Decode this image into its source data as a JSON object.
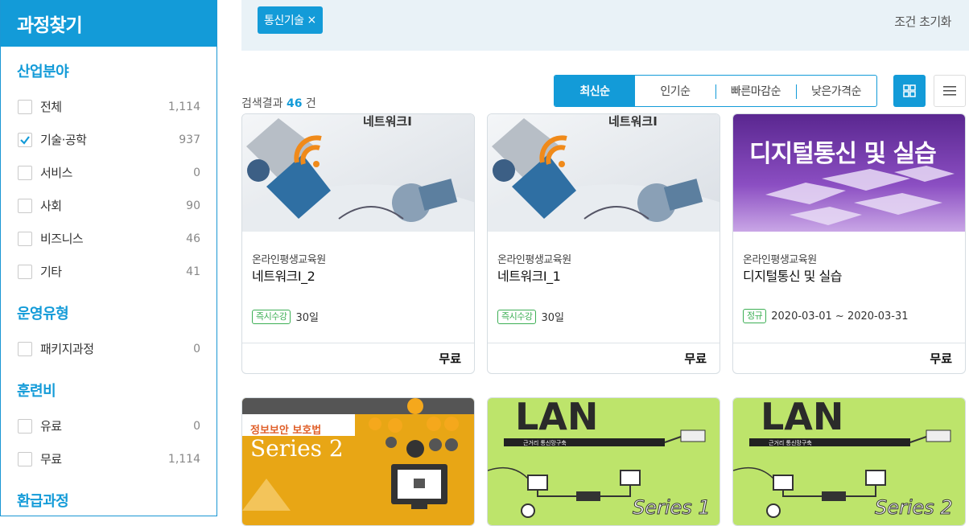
{
  "sidebar": {
    "title": "과정찾기",
    "sections": [
      {
        "title": "산업분야",
        "items": [
          {
            "label": "전체",
            "count": "1,114",
            "checked": false
          },
          {
            "label": "기술·공학",
            "count": "937",
            "checked": true
          },
          {
            "label": "서비스",
            "count": "0",
            "checked": false
          },
          {
            "label": "사회",
            "count": "90",
            "checked": false
          },
          {
            "label": "비즈니스",
            "count": "46",
            "checked": false
          },
          {
            "label": "기타",
            "count": "41",
            "checked": false
          }
        ]
      },
      {
        "title": "운영유형",
        "items": [
          {
            "label": "패키지과정",
            "count": "0",
            "checked": false
          }
        ]
      },
      {
        "title": "훈련비",
        "items": [
          {
            "label": "유료",
            "count": "0",
            "checked": false
          },
          {
            "label": "무료",
            "count": "1,114",
            "checked": false
          }
        ]
      },
      {
        "title": "환급과정",
        "items": []
      }
    ]
  },
  "filter_bar": {
    "tag_label": "통신기술",
    "tag_close": "×",
    "reset_label": "조건 초기화"
  },
  "results": {
    "prefix": "검색결과",
    "count": "46",
    "suffix": "건"
  },
  "sort_tabs": [
    "최신순",
    "인기순",
    "빠른마감순",
    "낮은가격순"
  ],
  "cards": [
    {
      "provider": "온라인평생교육원",
      "title": "네트워크Ⅰ_2",
      "badge": "즉시수강",
      "meta": "30일",
      "price": "무료",
      "thumb_text": "네트워크Ⅰ"
    },
    {
      "provider": "온라인평생교육원",
      "title": "네트워크Ⅰ_1",
      "badge": "즉시수강",
      "meta": "30일",
      "price": "무료",
      "thumb_text": "네트워크Ⅰ"
    },
    {
      "provider": "온라인평생교육원",
      "title": "디지털통신 및 실습",
      "badge": "정규",
      "meta": "2020-03-01 ~ 2020-03-31",
      "price": "무료",
      "thumb_text": "디지털통신 및 실습"
    },
    {
      "thumb_text": "정보보안 보호법",
      "thumb_sub": "Series 2"
    },
    {
      "thumb_text": "LAN",
      "thumb_caption": "근거리 통신망구축",
      "thumb_sub": "Series 1"
    },
    {
      "thumb_text": "LAN",
      "thumb_caption": "근거리 통신망구축",
      "thumb_sub": "Series 2"
    }
  ],
  "colors": {
    "accent": "#139bd8",
    "badge_green": "#3daf55",
    "filter_bg": "#e9f2f7"
  }
}
